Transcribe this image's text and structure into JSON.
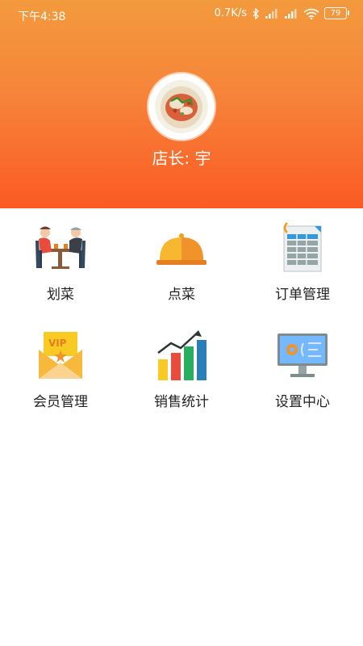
{
  "status_bar": {
    "time": "下午4:38",
    "net_speed": "0.7K/s",
    "battery": "79"
  },
  "profile": {
    "owner_label": "店长:",
    "owner_name": "宇"
  },
  "menu": {
    "items": [
      {
        "label": "划菜",
        "icon": "diners-icon"
      },
      {
        "label": "点菜",
        "icon": "food-cloche-icon"
      },
      {
        "label": "订单管理",
        "icon": "order-sheet-icon"
      },
      {
        "label": "会员管理",
        "icon": "vip-card-icon"
      },
      {
        "label": "销售统计",
        "icon": "bar-chart-icon"
      },
      {
        "label": "设置中心",
        "icon": "settings-monitor-icon"
      }
    ]
  },
  "colors": {
    "header_top": "#f39a3d",
    "header_bottom": "#fb5a23"
  }
}
